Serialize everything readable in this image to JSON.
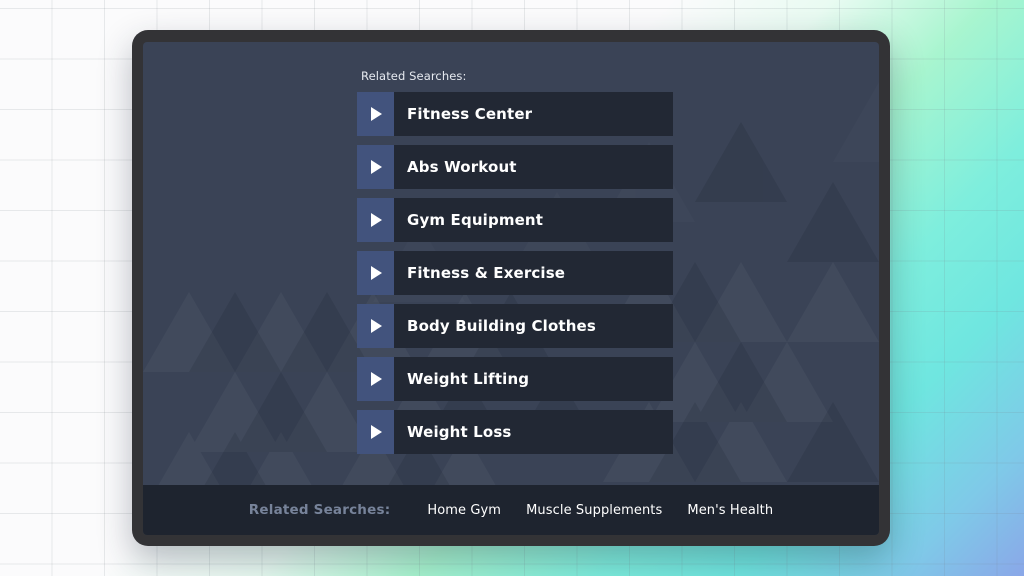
{
  "screen": {
    "background_color": "#3a4356",
    "frame_color": "#333336"
  },
  "results_panel": {
    "heading": "Related Searches:",
    "arrow_icon": "play-triangle-icon",
    "arrow_button_color": "#42537d",
    "row_color": "#222834",
    "items": [
      {
        "label": "Fitness Center"
      },
      {
        "label": "Abs Workout"
      },
      {
        "label": "Gym Equipment"
      },
      {
        "label": "Fitness & Exercise"
      },
      {
        "label": "Body Building Clothes"
      },
      {
        "label": "Weight Lifting"
      },
      {
        "label": "Weight Loss"
      }
    ]
  },
  "footer": {
    "label": "Related Searches:",
    "label_color": "#77839a",
    "background_color": "#1e242f",
    "links": [
      {
        "label": "Home Gym"
      },
      {
        "label": "Muscle Supplements"
      },
      {
        "label": "Men's Health"
      }
    ]
  }
}
